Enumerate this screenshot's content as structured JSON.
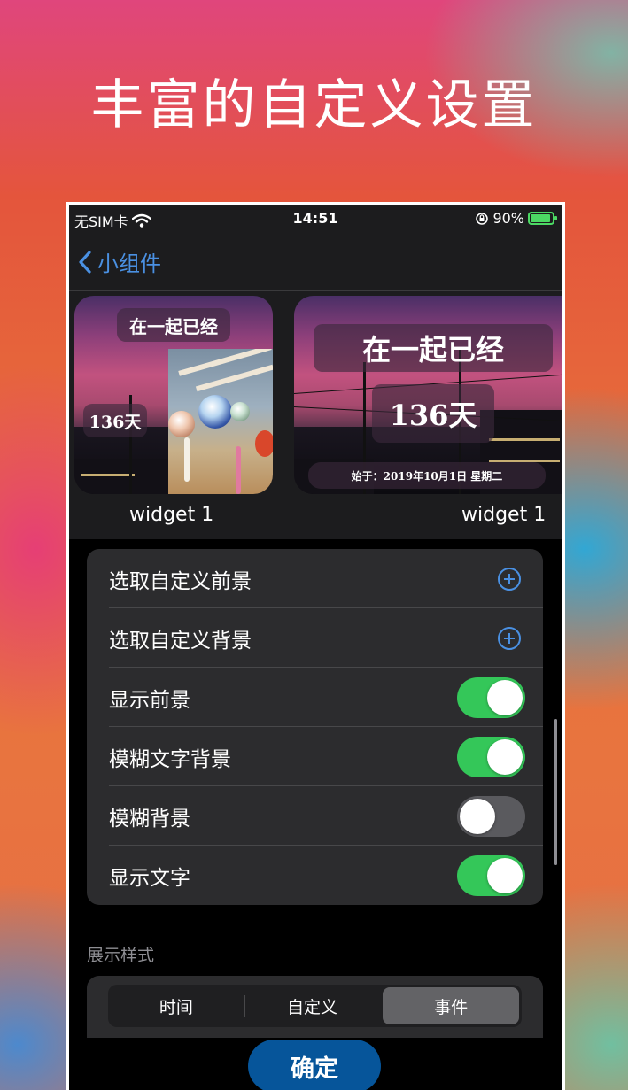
{
  "hero": {
    "title": "丰富的自定义设置"
  },
  "status_bar": {
    "carrier": "无SIM卡",
    "time": "14:51",
    "battery": "90%",
    "battery_level": 0.9
  },
  "nav": {
    "back_label": "小组件"
  },
  "widgets": [
    {
      "label": "widget 1",
      "title": "在一起已经",
      "days": "136天"
    },
    {
      "label": "widget 1",
      "title": "在一起已经",
      "days": "136天",
      "since": "始于：2019年10月1日 星期二"
    }
  ],
  "settings": {
    "rows": [
      {
        "label": "选取自定义前景",
        "control": "add"
      },
      {
        "label": "选取自定义背景",
        "control": "add"
      },
      {
        "label": "显示前景",
        "control": "toggle",
        "on": true
      },
      {
        "label": "模糊文字背景",
        "control": "toggle",
        "on": true
      },
      {
        "label": "模糊背景",
        "control": "toggle",
        "on": false
      },
      {
        "label": "显示文字",
        "control": "toggle",
        "on": true
      }
    ]
  },
  "display_style": {
    "title": "展示样式",
    "options": [
      "时间",
      "自定义",
      "事件"
    ],
    "selected": "事件"
  },
  "confirm_label": "确定",
  "colors": {
    "accent": "#4a90e2",
    "toggle_on": "#34c759",
    "confirm": "#06559a"
  }
}
